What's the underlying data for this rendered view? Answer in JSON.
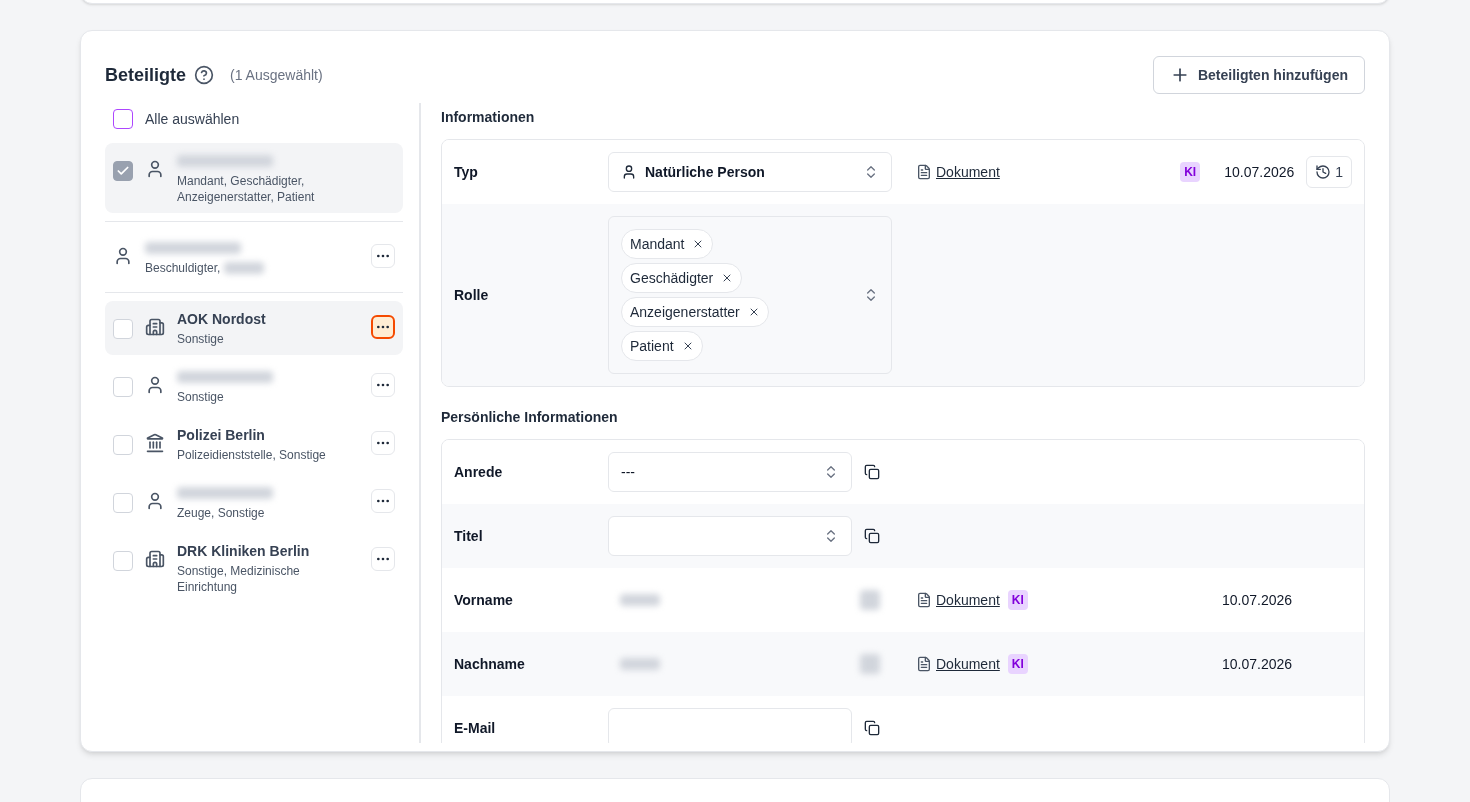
{
  "header": {
    "title": "Beteiligte",
    "selection_count": "(1 Ausgewählt)",
    "add_button": "Beteiligten hinzufügen"
  },
  "select_all": {
    "label": "Alle auswählen",
    "checked": false
  },
  "groups": [
    [
      {
        "kind": "person",
        "roles": "Mandant, Geschädigter, Anzeigenerstatter, Patient",
        "checked": true,
        "selected": true
      }
    ],
    [
      {
        "kind": "person",
        "roles": "Beschuldigter,",
        "roles_redacted": true,
        "selected": false,
        "focused": false
      }
    ],
    [
      {
        "kind": "organization",
        "name": "AOK Nordost",
        "roles": "Sonstige",
        "checked": false,
        "selected": true,
        "focused": true
      },
      {
        "kind": "person",
        "roles": "Sonstige",
        "checked": false,
        "selected": false,
        "focused": false
      },
      {
        "kind": "authority",
        "name": "Polizei Berlin",
        "roles": "Polizeidienststelle, Sonstige",
        "checked": false,
        "selected": false,
        "focused": false
      },
      {
        "kind": "person",
        "roles": "Zeuge, Sonstige",
        "checked": false,
        "selected": false,
        "focused": false
      },
      {
        "kind": "organization",
        "name": "DRK Kliniken Berlin",
        "roles": "Sonstige, Medizinische Einrichtung",
        "checked": false,
        "selected": false,
        "focused": false
      }
    ]
  ],
  "sections": [
    {
      "title": "Informationen",
      "rows": [
        {
          "kind": "select",
          "label": "Typ",
          "value": "Natürliche Person",
          "value_has_icon": true,
          "source": "Dokument",
          "ki": "KI",
          "ki_beside_source": false,
          "date": "10.07.2026",
          "history": "1"
        },
        {
          "kind": "tags",
          "label": "Rolle",
          "tags": [
            "Mandant",
            "Geschädigter",
            "Anzeigenerstatter",
            "Patient"
          ]
        }
      ]
    },
    {
      "title": "Persönliche Informationen",
      "rows": [
        {
          "kind": "select",
          "label": "Anrede",
          "value": "---",
          "copy": true
        },
        {
          "kind": "select",
          "label": "Titel",
          "copy": true
        },
        {
          "kind": "redacted",
          "label": "Vorname",
          "source": "Dokument",
          "ki": "KI",
          "ki_beside_source": true,
          "date": "10.07.2026"
        },
        {
          "kind": "redacted",
          "label": "Nachname",
          "source": "Dokument",
          "ki": "KI",
          "ki_beside_source": true,
          "date": "10.07.2026"
        },
        {
          "kind": "input",
          "label": "E-Mail",
          "copy": true
        }
      ]
    }
  ]
}
